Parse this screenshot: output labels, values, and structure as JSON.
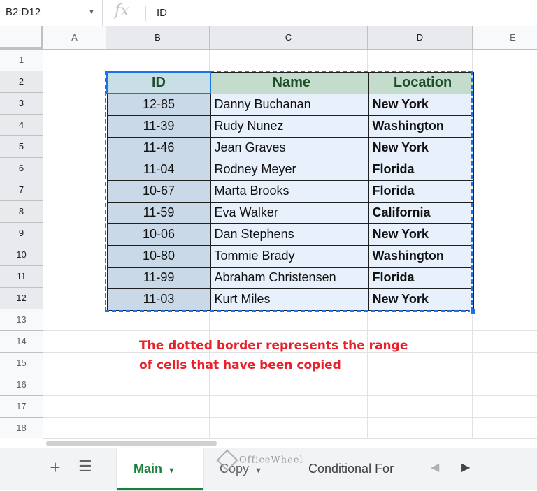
{
  "formula_bar": {
    "name_box": "B2:D12",
    "fx": "fx",
    "value": "ID"
  },
  "columns": [
    "A",
    "B",
    "C",
    "D",
    "E"
  ],
  "rows": [
    "1",
    "2",
    "3",
    "4",
    "5",
    "6",
    "7",
    "8",
    "9",
    "10",
    "11",
    "12",
    "13",
    "14",
    "15",
    "16",
    "17",
    "18"
  ],
  "table": {
    "headers": [
      "ID",
      "Name",
      "Location"
    ],
    "rows": [
      [
        "12-85",
        "Danny Buchanan",
        "New York"
      ],
      [
        "11-39",
        "Rudy Nunez",
        "Washington"
      ],
      [
        "11-46",
        "Jean Graves",
        "New York"
      ],
      [
        "11-04",
        "Rodney Meyer",
        "Florida"
      ],
      [
        "10-67",
        "Marta Brooks",
        "Florida"
      ],
      [
        "11-59",
        "Eva Walker",
        "California"
      ],
      [
        "10-06",
        "Dan Stephens",
        "New York"
      ],
      [
        "10-80",
        "Tommie Brady",
        "Washington"
      ],
      [
        "11-99",
        "Abraham Christensen",
        "Florida"
      ],
      [
        "11-03",
        "Kurt Miles",
        "New York"
      ]
    ]
  },
  "note": {
    "line1": "The dotted border represents the range",
    "line2": "of cells that have been copied"
  },
  "tabs": {
    "active": "Main",
    "copy": "Copy",
    "cond": "Conditional For"
  },
  "watermark": "OfficeWheel",
  "colors": {
    "selection": "#1a73e8",
    "header_fill": "#c4dccb",
    "note": "#e8202a",
    "active_tab": "#188038"
  }
}
